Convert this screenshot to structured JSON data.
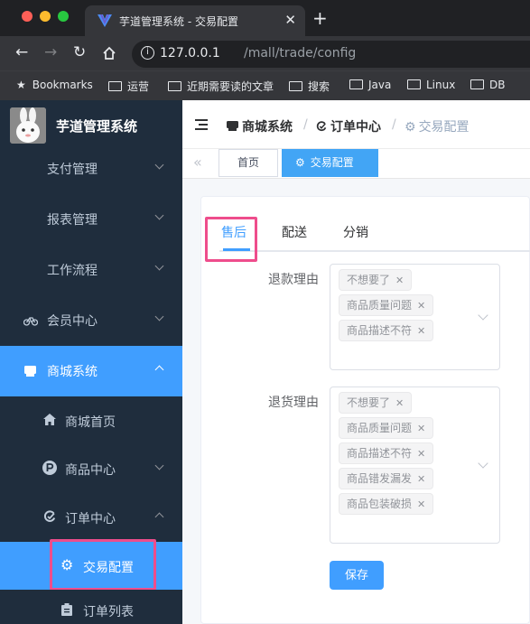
{
  "browser": {
    "tab_title": "芋道管理系统 - 交易配置",
    "tab_close": "✕",
    "new_tab": "+",
    "url_host": "127.0.0.1",
    "url_path": "/mall/trade/config",
    "bookmarks_label": "Bookmarks",
    "bookmark_folders": [
      "运营",
      "近期需要读的文章",
      "搜索",
      "Java",
      "Linux",
      "DB"
    ]
  },
  "sidebar": {
    "brand": "芋道管理系统",
    "menus": [
      {
        "label": "支付管理"
      },
      {
        "label": "报表管理"
      },
      {
        "label": "工作流程"
      },
      {
        "label": "会员中心"
      },
      {
        "label": "商城系统"
      },
      {
        "label": "商城首页"
      },
      {
        "label": "商品中心"
      },
      {
        "label": "订单中心"
      },
      {
        "label": "交易配置"
      },
      {
        "label": "订单列表"
      }
    ]
  },
  "breadcrumb": {
    "items": [
      "商城系统",
      "订单中心",
      "交易配置"
    ],
    "separator": "/"
  },
  "tags": {
    "home": "首页",
    "current": "交易配置"
  },
  "tabs": [
    "售后",
    "配送",
    "分销"
  ],
  "form": {
    "refund_label": "退款理由",
    "refund_reasons": [
      "不想要了",
      "商品质量问题",
      "商品描述不符"
    ],
    "return_label": "退货理由",
    "return_reasons": [
      "不想要了",
      "商品质量问题",
      "商品描述不符",
      "商品错发漏发",
      "商品包装破损"
    ],
    "save": "保存"
  },
  "colors": {
    "accent": "#409eff",
    "sidebar_bg": "#1f2d3d",
    "highlight": "#ee4d8c"
  }
}
